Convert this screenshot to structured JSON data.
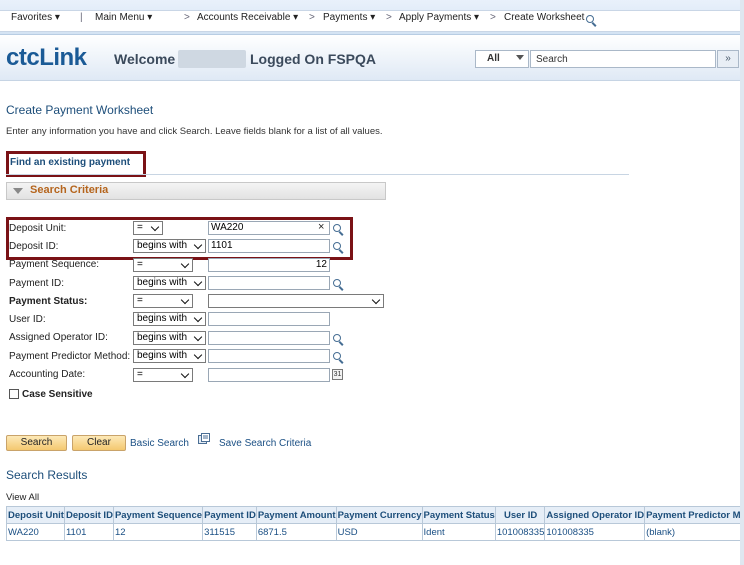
{
  "nav": {
    "favorites": "Favorites",
    "main_menu": "Main Menu",
    "breadcrumbs": [
      "Accounts Receivable",
      "Payments",
      "Apply Payments",
      "Create Worksheet"
    ],
    "separator": ">"
  },
  "header": {
    "logo": "ctcLink",
    "welcome": "Welcome",
    "logged_on": "Logged On FSPQA",
    "search_scope": "All",
    "search_placeholder": "Search",
    "search_go": "»"
  },
  "page": {
    "title": "Create Payment Worksheet",
    "instructions": "Enter any information you have and click Search. Leave fields blank for a list of all values.",
    "tab": "Find an existing payment",
    "section": "Search Criteria"
  },
  "fields": [
    {
      "label": "Deposit Unit:",
      "operator": "=",
      "value": "WA220",
      "bold": false
    },
    {
      "label": "Deposit ID:",
      "operator": "begins with",
      "value": "1101",
      "bold": false
    },
    {
      "label": "Payment Sequence:",
      "operator": "=",
      "value": "12",
      "bold": false
    },
    {
      "label": "Payment ID:",
      "operator": "begins with",
      "value": "",
      "bold": false
    },
    {
      "label": "Payment Status:",
      "operator": "=",
      "value": "",
      "bold": true
    },
    {
      "label": "User ID:",
      "operator": "begins with",
      "value": "",
      "bold": false
    },
    {
      "label": "Assigned Operator ID:",
      "operator": "begins with",
      "value": "",
      "bold": false
    },
    {
      "label": "Payment Predictor Method:",
      "operator": "begins with",
      "value": "",
      "bold": false
    },
    {
      "label": "Accounting Date:",
      "operator": "=",
      "value": "",
      "bold": false
    }
  ],
  "case_sensitive": "Case Sensitive",
  "buttons": {
    "search": "Search",
    "clear": "Clear",
    "basic_search": "Basic Search",
    "save_criteria": "Save Search Criteria",
    "clear_x": "×",
    "calendar": "31"
  },
  "results": {
    "title": "Search Results",
    "view_all": "View All",
    "columns": [
      "Deposit Unit",
      "Deposit ID",
      "Payment Sequence",
      "Payment ID",
      "Payment Amount",
      "Payment Currency",
      "Payment Status",
      "User ID",
      "Assigned Operator ID",
      "Payment Predictor Method"
    ],
    "rows": [
      [
        "WA220",
        "1101",
        "12",
        "311515",
        "6871.5",
        "USD",
        "Ident",
        "101008335",
        "101008335",
        "(blank)"
      ]
    ]
  },
  "colors": {
    "accent": "#1d4e7a",
    "highlight_box": "#7a1216",
    "section_label": "#b5651d",
    "button": "#f4c870"
  }
}
